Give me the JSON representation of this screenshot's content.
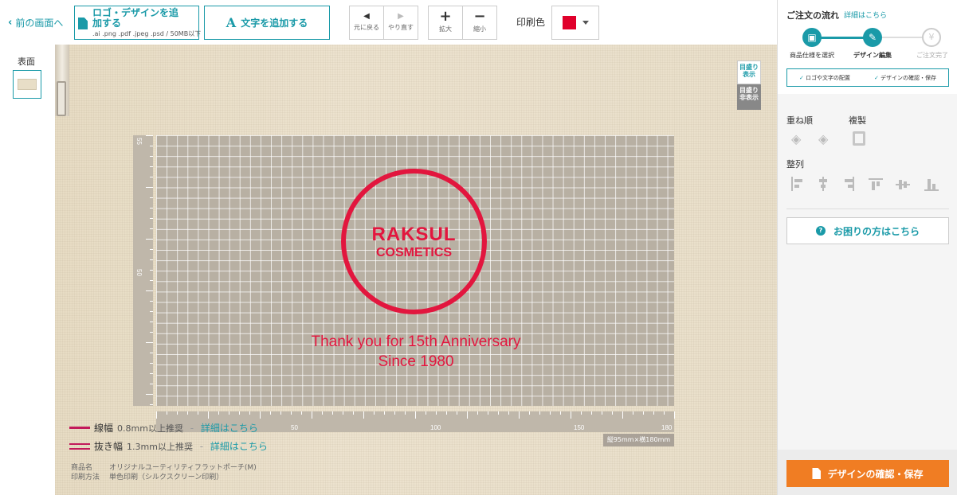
{
  "toolbar": {
    "back_label": "前の画面へ",
    "upload_label": "ロゴ・デザインを追加する",
    "upload_formats": ".ai .png .pdf .jpeg .psd / 50MB以下",
    "add_text_label": "文字を追加する",
    "undo_label": "元に戻る",
    "redo_label": "やり直す",
    "zoom_in_label": "拡大",
    "zoom_out_label": "縮小",
    "print_color_label": "印刷色",
    "print_color": "#e0002b"
  },
  "pages": {
    "label": "表面"
  },
  "canvas": {
    "guide_show": "目盛り表示",
    "guide_hide": "目盛り非表示",
    "logo_line1": "RAKSUL",
    "logo_line2": "COSMETICS",
    "text_line1": "Thank you for 15th Anniversary",
    "text_line2": "Since 1980",
    "ruler_left": [
      "55",
      "50"
    ],
    "ruler_bottom": [
      "50",
      "100",
      "150",
      "180"
    ],
    "size_label": "縦95mm×横180mm",
    "line_width_label": "線幅",
    "line_width_value": "0.8mm以上推奨",
    "gap_width_label": "抜き幅",
    "gap_width_value": "1.3mm以上推奨",
    "detail_link": "詳細はこちら",
    "detail_sep": " - ",
    "product_label": "商品名",
    "product_value": "オリジナルユーティリティフラットポーチ(M)",
    "method_label": "印刷方法",
    "method_value": "単色印刷（シルクスクリーン印刷）"
  },
  "sidebar": {
    "flow_title": "ご注文の流れ",
    "flow_link": "詳細はこちら",
    "steps": [
      "商品仕様を選択",
      "デザイン編集",
      "ご注文完了"
    ],
    "checks": [
      "ロゴや文字の配置",
      "デザインの確認・保存"
    ],
    "order_label": "重ね順",
    "duplicate_label": "複製",
    "align_label": "整列",
    "help_label": "お困りの方はこちら",
    "save_label": "デザインの確認・保存"
  }
}
